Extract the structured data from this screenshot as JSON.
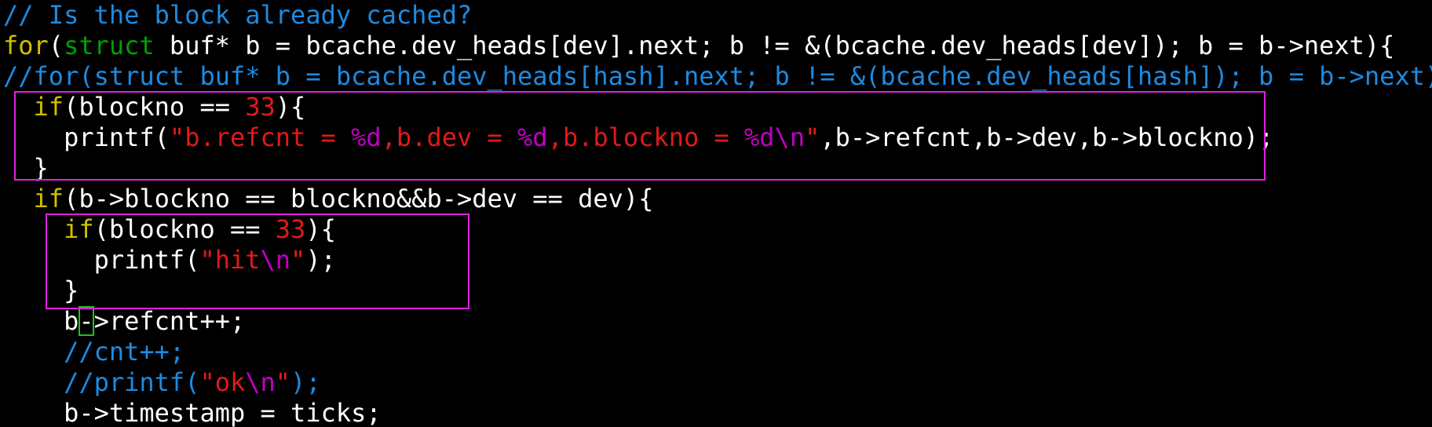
{
  "colors": {
    "background": "#000000",
    "default": "#ffffff",
    "comment": "#1e8ae0",
    "keyword": "#d0c000",
    "type": "#00a000",
    "string": "#e01a1a",
    "special": "#c000c0",
    "number": "#e01a1a",
    "highlight_box": "#e020e0",
    "cursor": "#20c020"
  },
  "cursor": {
    "line": 10,
    "col": 5
  },
  "lines": [
    [
      [
        "comment",
        "// Is the block already cached?"
      ]
    ],
    [
      [
        "keyword",
        "for"
      ],
      [
        "default",
        "("
      ],
      [
        "type",
        "struct"
      ],
      [
        "default",
        " buf* b = bcache.dev_heads[dev].next; b != &(bcache.dev_heads[dev]); b = b->next){"
      ]
    ],
    [
      [
        "comment",
        "//for(struct buf* b = bcache.dev_heads[hash].next; b != &(bcache.dev_heads[hash]); b = b->next){"
      ]
    ],
    [
      [
        "default",
        "  "
      ],
      [
        "keyword",
        "if"
      ],
      [
        "default",
        "(blockno == "
      ],
      [
        "number",
        "33"
      ],
      [
        "default",
        "){"
      ]
    ],
    [
      [
        "default",
        "    printf("
      ],
      [
        "string",
        "\"b.refcnt = "
      ],
      [
        "special",
        "%d"
      ],
      [
        "string",
        ",b.dev = "
      ],
      [
        "special",
        "%d"
      ],
      [
        "string",
        ",b.blockno = "
      ],
      [
        "special",
        "%d\\n"
      ],
      [
        "string",
        "\""
      ],
      [
        "default",
        ",b->refcnt,b->dev,b->blockno);"
      ]
    ],
    [
      [
        "default",
        "  }"
      ]
    ],
    [
      [
        "default",
        "  "
      ],
      [
        "keyword",
        "if"
      ],
      [
        "default",
        "(b->blockno == blockno&&b->dev == dev){"
      ]
    ],
    [
      [
        "default",
        "    "
      ],
      [
        "keyword",
        "if"
      ],
      [
        "default",
        "(blockno == "
      ],
      [
        "number",
        "33"
      ],
      [
        "default",
        "){"
      ]
    ],
    [
      [
        "default",
        "      printf("
      ],
      [
        "string",
        "\"hit"
      ],
      [
        "special",
        "\\n"
      ],
      [
        "string",
        "\""
      ],
      [
        "default",
        ");"
      ]
    ],
    [
      [
        "default",
        "    }"
      ]
    ],
    [
      [
        "default",
        "    b->refcnt++;"
      ]
    ],
    [
      [
        "default",
        "    "
      ],
      [
        "comment",
        "//cnt++;"
      ]
    ],
    [
      [
        "default",
        "    "
      ],
      [
        "comment",
        "//printf("
      ],
      [
        "string",
        "\"ok"
      ],
      [
        "special",
        "\\n"
      ],
      [
        "string",
        "\""
      ],
      [
        "comment",
        ");"
      ]
    ],
    [
      [
        "default",
        "    b->timestamp = ticks;"
      ]
    ]
  ]
}
